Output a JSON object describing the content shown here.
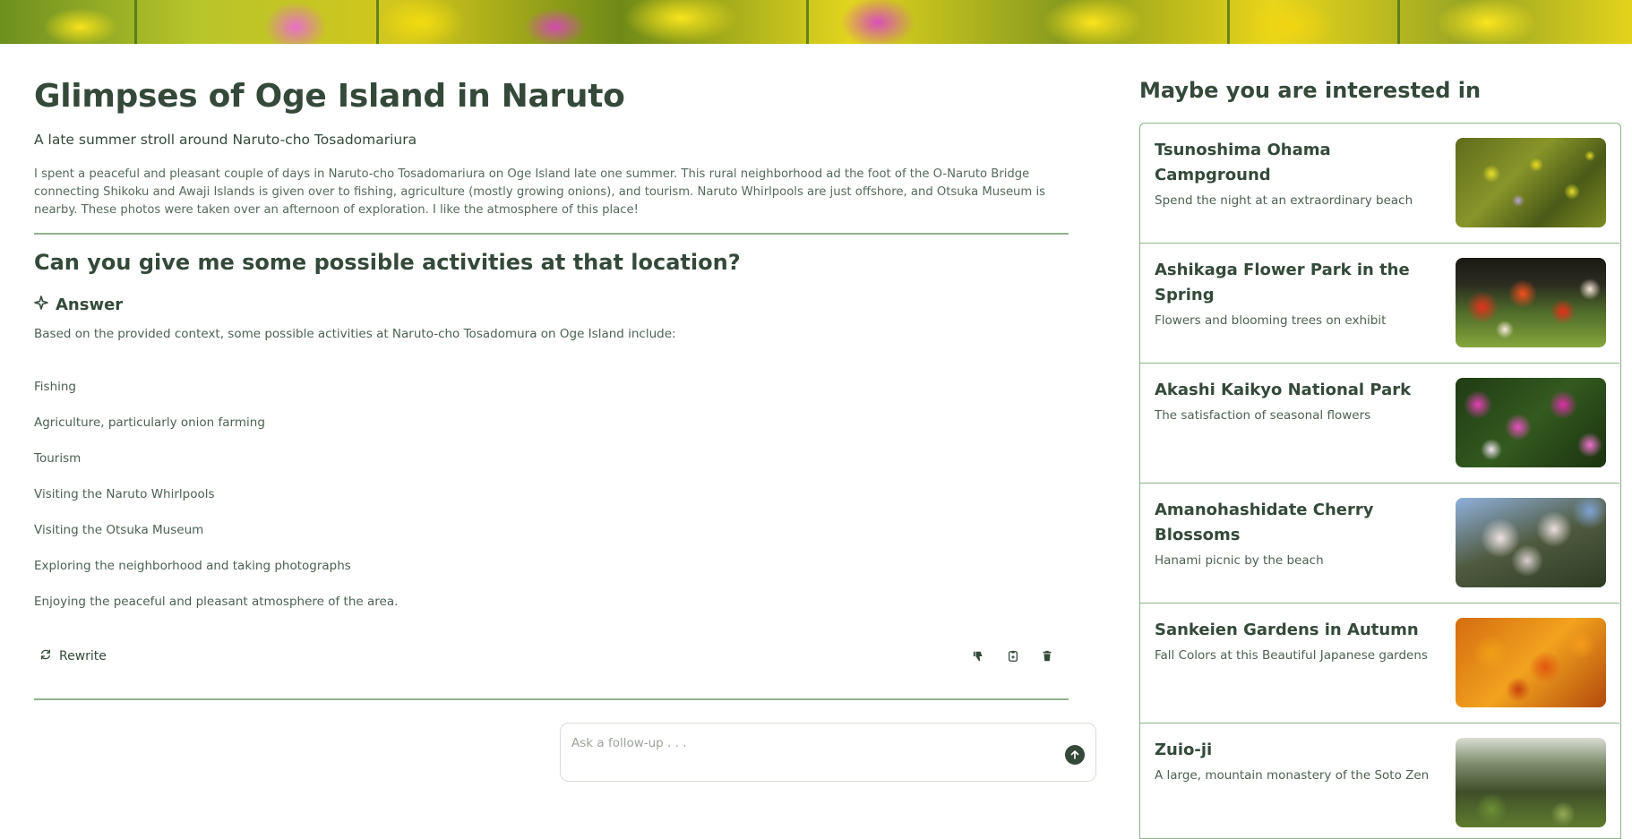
{
  "article": {
    "title": "Glimpses of Oge Island in Naruto",
    "subtitle": "A late summer stroll around Naruto-cho Tosadomariura",
    "intro": "I spent a peaceful and pleasant couple of days in Naruto-cho Tosadomariura on Oge Island late one summer. This rural neighborhood ad the foot of the O-Naruto Bridge connecting Shikoku and Awaji Islands is given over to fishing, agriculture (mostly growing onions), and tourism. Naruto Whirlpools are just offshore, and Otsuka Museum is nearby. These photos were taken over an afternoon of exploration. I like the atmosphere of this place!"
  },
  "qa": {
    "question": "Can you give me some possible activities at that location?",
    "answer_heading": "Answer",
    "answer_intro": "Based on the provided context, some possible activities at Naruto-cho Tosadomura on Oge Island include:",
    "activities": [
      "Fishing",
      "Agriculture, particularly onion farming",
      "Tourism",
      "Visiting the Naruto Whirlpools",
      "Visiting the Otsuka Museum",
      "Exploring the neighborhood and taking photographs",
      "Enjoying the peaceful and pleasant atmosphere of the area."
    ],
    "rewrite_label": "Rewrite"
  },
  "followup": {
    "placeholder": "Ask a follow-up . . ."
  },
  "sidebar": {
    "title": "Maybe you are interested in",
    "cards": [
      {
        "title": "Tsunoshima Ohama Campground",
        "desc": "Spend the night at an extraordinary beach"
      },
      {
        "title": "Ashikaga Flower Park in the Spring",
        "desc": "Flowers and blooming trees on exhibit"
      },
      {
        "title": "Akashi Kaikyo National Park",
        "desc": "The satisfaction of seasonal flowers"
      },
      {
        "title": "Amanohashidate Cherry Blossoms",
        "desc": "Hanami picnic by the beach"
      },
      {
        "title": "Sankeien Gardens in Autumn",
        "desc": "Fall Colors at this Beautiful Japanese gardens"
      },
      {
        "title": "Zuio-ji",
        "desc": "A large, mountain monastery of the Soto Zen"
      }
    ]
  },
  "icons": {
    "sparkle": "sparkle-icon",
    "rewrite": "refresh-icon",
    "dislike": "thumbs-down-icon",
    "copy": "copy-icon",
    "delete": "trash-icon",
    "send": "arrow-up-icon"
  },
  "colors": {
    "text": "#34493a",
    "accent_border": "#8fb48a",
    "send_button": "#34493a"
  }
}
